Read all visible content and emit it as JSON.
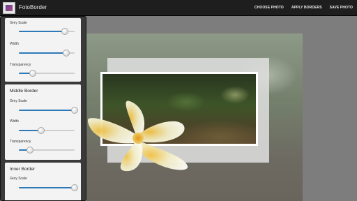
{
  "app": {
    "title": "FotoBorder"
  },
  "toolbar": {
    "choose_photo": "CHOOSE PHOTO",
    "apply_borders": "APPLY BORDERS",
    "save_photo": "SAVE PHOTO"
  },
  "sections": {
    "outer": {
      "sliders": [
        {
          "label": "Grey Scale",
          "value": 0.82
        },
        {
          "label": "Width",
          "value": 0.85
        },
        {
          "label": "Transparency",
          "value": 0.25
        }
      ]
    },
    "middle": {
      "title": "Middle Border",
      "sliders": [
        {
          "label": "Grey Scale",
          "value": 1.0
        },
        {
          "label": "Width",
          "value": 0.4
        },
        {
          "label": "Transparency",
          "value": 0.2
        }
      ]
    },
    "inner": {
      "title": "Inner Border",
      "sliders": [
        {
          "label": "Grey Scale",
          "value": 1.0
        }
      ]
    }
  },
  "colors": {
    "accent": "#2e7ab8",
    "actionbar": "#1e1e1e",
    "panel": "#3a3a3a"
  }
}
